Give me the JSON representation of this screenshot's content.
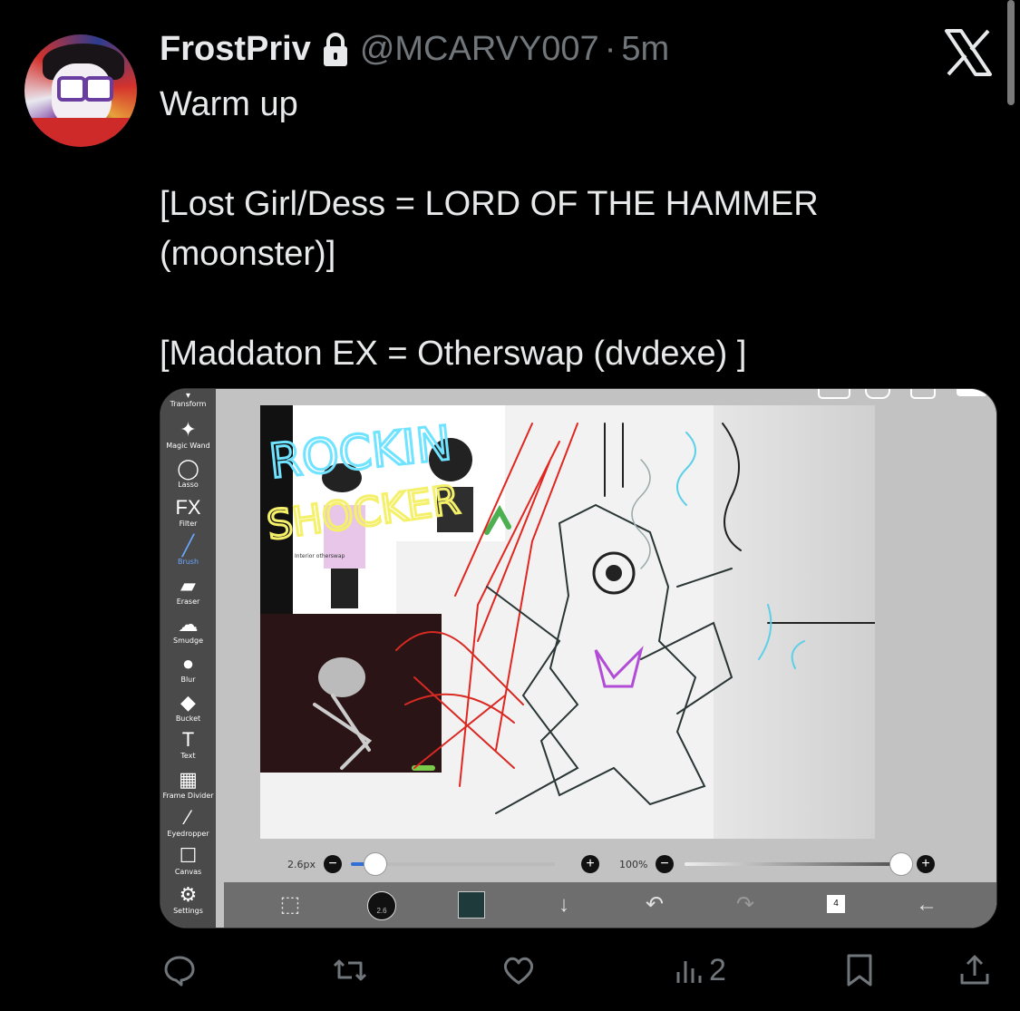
{
  "tweet": {
    "display_name": "FrostPriv",
    "handle": "@MCARVY007",
    "separator": "·",
    "time": "5m",
    "text": {
      "line1": "Warm up",
      "line2": "[Lost Girl/Dess = LORD OF THE HAMMER",
      "line3": "(moonster)]",
      "line4": "[Maddaton EX = Otherswap (dvdexe) ]"
    }
  },
  "media": {
    "tools": [
      {
        "label": "Transform",
        "icon": "transform-icon"
      },
      {
        "label": "Magic Wand",
        "icon": "magic-wand-icon"
      },
      {
        "label": "Lasso",
        "icon": "lasso-icon"
      },
      {
        "label": "Filter",
        "icon": "fx-icon",
        "glyph": "FX"
      },
      {
        "label": "Brush",
        "icon": "brush-icon"
      },
      {
        "label": "Eraser",
        "icon": "eraser-icon"
      },
      {
        "label": "Smudge",
        "icon": "smudge-icon"
      },
      {
        "label": "Blur",
        "icon": "blur-icon"
      },
      {
        "label": "Bucket",
        "icon": "bucket-icon"
      },
      {
        "label": "Text",
        "icon": "text-icon",
        "glyph": "T"
      },
      {
        "label": "Frame Divider",
        "icon": "frame-divider-icon"
      },
      {
        "label": "Eyedropper",
        "icon": "eyedropper-icon"
      },
      {
        "label": "Canvas",
        "icon": "canvas-icon"
      },
      {
        "label": "Settings",
        "icon": "settings-icon"
      }
    ],
    "active_tool": "Brush",
    "brush_size": "2.6px",
    "opacity": "100%",
    "layer_count": "4",
    "brush_size_badge": "2.6",
    "canvas_artwork_text": [
      "ROCKIN",
      "SHOCKER"
    ],
    "ref_caption": "Interior\notherswap",
    "colors": {
      "accent_tool": "#6aa6ff",
      "current_color": "#1e3a3a"
    }
  },
  "actions": {
    "views": "2",
    "icons": [
      "reply-icon",
      "retweet-icon",
      "like-icon",
      "views-icon",
      "bookmark-icon",
      "share-icon"
    ]
  }
}
